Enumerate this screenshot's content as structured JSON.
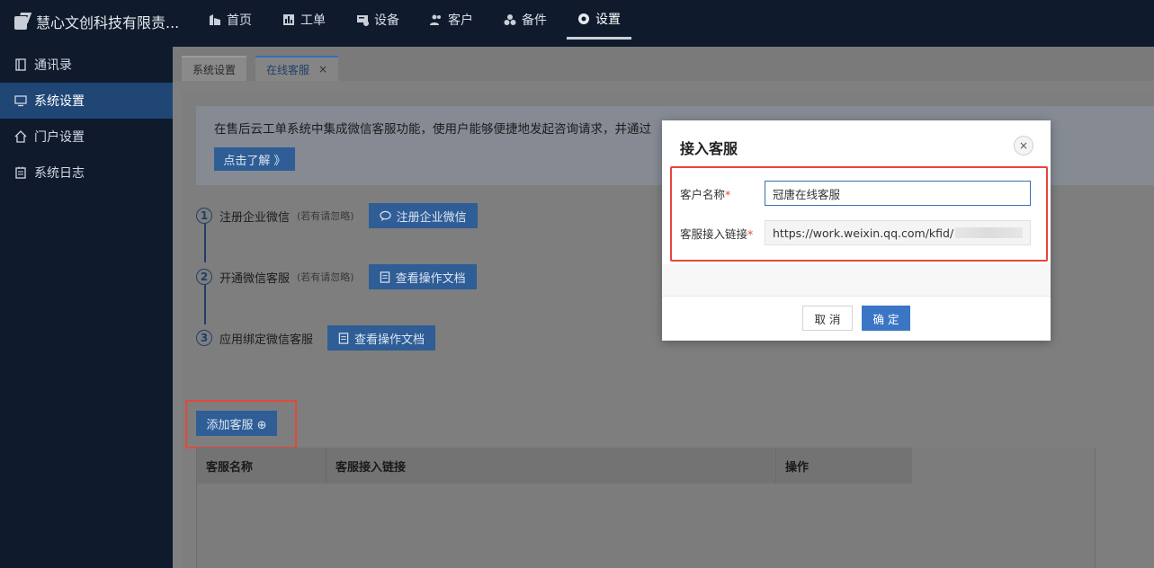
{
  "brand": {
    "name": "慧心文创科技有限责..."
  },
  "nav": [
    {
      "label": "首页",
      "icon": "building-icon"
    },
    {
      "label": "工单",
      "icon": "bar-chart-icon"
    },
    {
      "label": "设备",
      "icon": "device-icon"
    },
    {
      "label": "客户",
      "icon": "users-icon"
    },
    {
      "label": "备件",
      "icon": "parts-icon"
    },
    {
      "label": "设置",
      "icon": "gear-icon"
    }
  ],
  "sidebar": [
    {
      "label": "通讯录",
      "icon": "contacts-icon"
    },
    {
      "label": "系统设置",
      "icon": "monitor-icon"
    },
    {
      "label": "门户设置",
      "icon": "home-icon"
    },
    {
      "label": "系统日志",
      "icon": "log-icon"
    }
  ],
  "tabs": [
    {
      "label": "系统设置"
    },
    {
      "label": "在线客服",
      "close": "×"
    }
  ],
  "banner": {
    "text": "在售后云工单系统中集成微信客服功能，使用户能够便捷地发起咨询请求，并通过",
    "button": "点击了解 》"
  },
  "steps": [
    {
      "num": "1",
      "label": "注册企业微信",
      "hint": "(若有请忽略)",
      "button": "注册企业微信",
      "icon": "chat-icon"
    },
    {
      "num": "2",
      "label": "开通微信客服",
      "hint": "(若有请忽略)",
      "button": "查看操作文档",
      "icon": "document-icon"
    },
    {
      "num": "3",
      "label": "应用绑定微信客服",
      "hint": "",
      "button": "查看操作文档",
      "icon": "document-icon"
    }
  ],
  "add_button": "添加客服 ⊕",
  "table": {
    "columns": [
      "客服名称",
      "客服接入链接",
      "操作"
    ]
  },
  "modal": {
    "title": "接入客服",
    "close": "×",
    "fields": [
      {
        "label": "客户名称",
        "required": "*",
        "value": "冠唐在线客服"
      },
      {
        "label": "客服接入链接",
        "required": "*",
        "value": "https://work.weixin.qq.com/kfid/"
      }
    ],
    "cancel": "取 消",
    "confirm": "确 定"
  },
  "colors": {
    "highlight": "#e5473a",
    "primary": "#3b76c4",
    "sidebar_active": "#1f4675"
  }
}
